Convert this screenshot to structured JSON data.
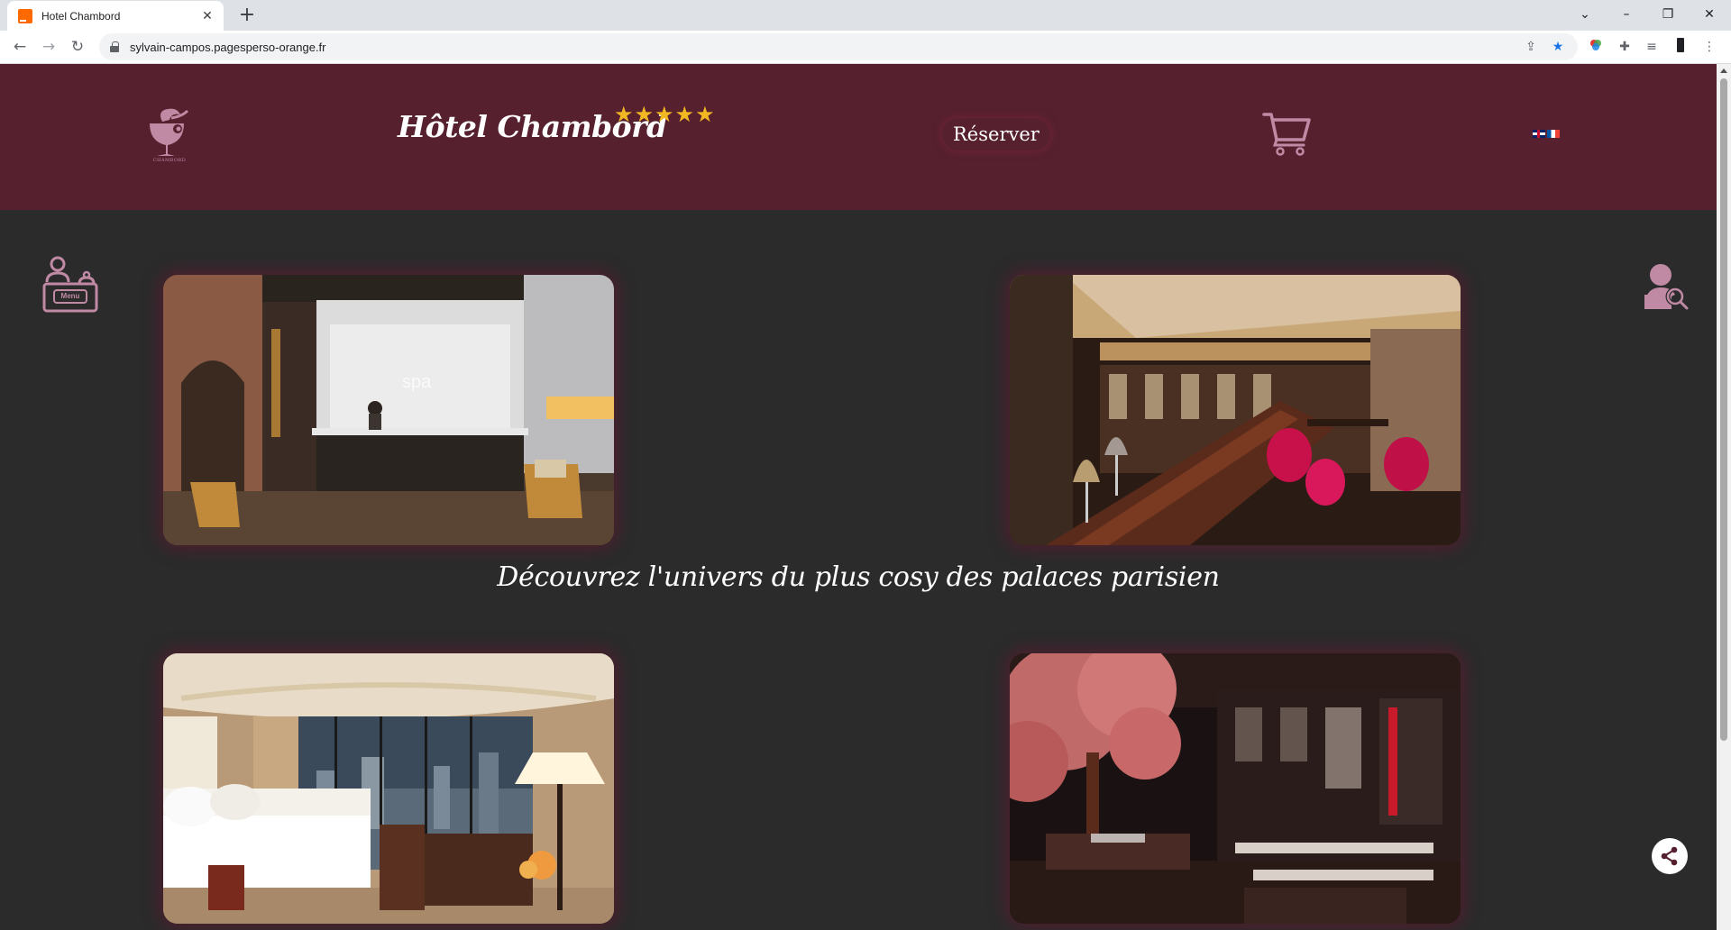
{
  "browser": {
    "tab_title": "Hotel Chambord",
    "url": "sylvain-campos.pagesperso-orange.fr"
  },
  "header": {
    "brand_name": "Hôtel Chambord",
    "stars": "★★★★★",
    "reserve_label": "Réserver",
    "logo_caption": "CHAMBORD"
  },
  "side": {
    "menu_label": "Menu"
  },
  "main": {
    "tagline": "Découvrez l'univers du plus cosy des palaces parisien"
  },
  "colors": {
    "header_bg": "#56202f",
    "page_bg": "#2b2b2c",
    "accent_pink": "#c08aa4",
    "star_gold": "#f2b823"
  },
  "icons": [
    "menu-icon",
    "user-search-icon",
    "cart-icon",
    "share-icon",
    "logo-icon"
  ]
}
